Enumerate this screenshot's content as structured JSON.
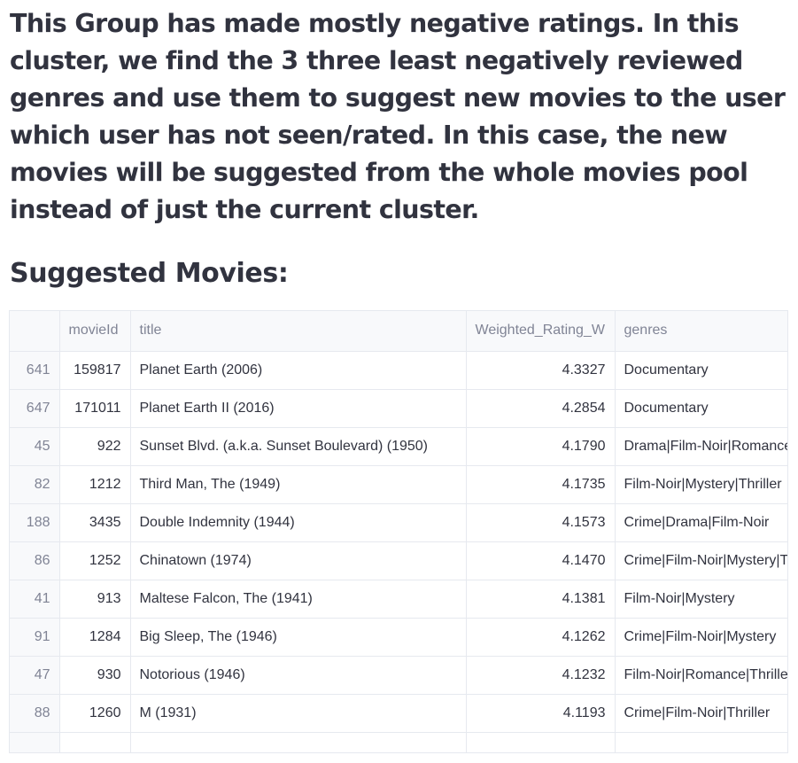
{
  "intro_text": "This Group has made mostly negative ratings. In this cluster, we find the 3 three least negatively reviewed genres and use them to suggest new movies to the user which user has not seen/rated. In this case, the new movies will be suggested from the whole movies pool instead of just the current cluster.",
  "section_title": "Suggested Movies:",
  "table": {
    "columns": {
      "index": "",
      "movieId": "movieId",
      "title": "title",
      "weighted": "Weighted_Rating_W",
      "genres": "genres"
    },
    "rows": [
      {
        "index": "641",
        "movieId": "159817",
        "title": "Planet Earth (2006)",
        "weighted": "4.3327",
        "genres": "Documentary"
      },
      {
        "index": "647",
        "movieId": "171011",
        "title": "Planet Earth II (2016)",
        "weighted": "4.2854",
        "genres": "Documentary"
      },
      {
        "index": "45",
        "movieId": "922",
        "title": "Sunset Blvd. (a.k.a. Sunset Boulevard) (1950)",
        "weighted": "4.1790",
        "genres": "Drama|Film-Noir|Romance"
      },
      {
        "index": "82",
        "movieId": "1212",
        "title": "Third Man, The (1949)",
        "weighted": "4.1735",
        "genres": "Film-Noir|Mystery|Thriller"
      },
      {
        "index": "188",
        "movieId": "3435",
        "title": "Double Indemnity (1944)",
        "weighted": "4.1573",
        "genres": "Crime|Drama|Film-Noir"
      },
      {
        "index": "86",
        "movieId": "1252",
        "title": "Chinatown (1974)",
        "weighted": "4.1470",
        "genres": "Crime|Film-Noir|Mystery|Thriller"
      },
      {
        "index": "41",
        "movieId": "913",
        "title": "Maltese Falcon, The (1941)",
        "weighted": "4.1381",
        "genres": "Film-Noir|Mystery"
      },
      {
        "index": "91",
        "movieId": "1284",
        "title": "Big Sleep, The (1946)",
        "weighted": "4.1262",
        "genres": "Crime|Film-Noir|Mystery"
      },
      {
        "index": "47",
        "movieId": "930",
        "title": "Notorious (1946)",
        "weighted": "4.1232",
        "genres": "Film-Noir|Romance|Thriller"
      },
      {
        "index": "88",
        "movieId": "1260",
        "title": "M (1931)",
        "weighted": "4.1193",
        "genres": "Crime|Film-Noir|Thriller"
      }
    ]
  }
}
